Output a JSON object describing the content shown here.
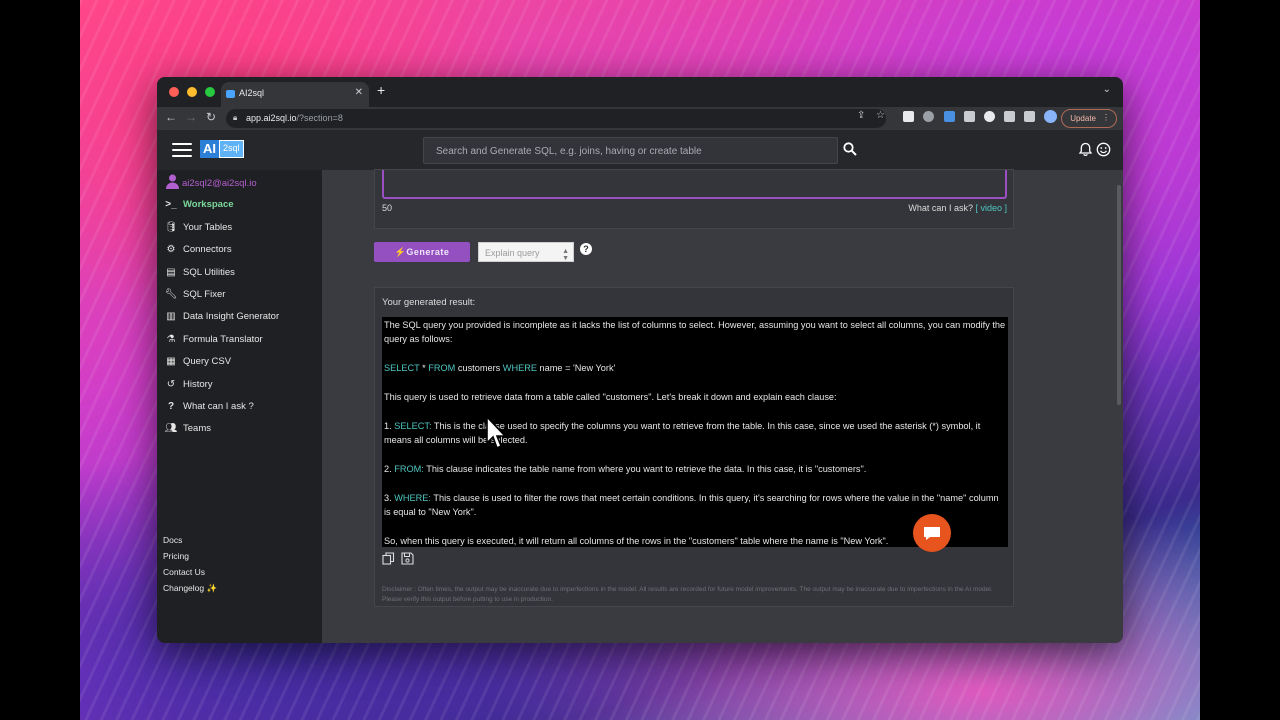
{
  "browser": {
    "tab_title": "AI2sql",
    "url_host": "app.ai2sql.io",
    "url_path": "/?section=8",
    "update_label": "Update"
  },
  "app": {
    "logo_ai": "AI",
    "logo_sql": "2sql",
    "search_placeholder": "Search and Generate SQL, e.g. joins, having or create table"
  },
  "sidebar": {
    "user_email": "ai2sql2@ai2sql.io",
    "items": [
      {
        "label": "Workspace",
        "icon": ">_"
      },
      {
        "label": "Your Tables",
        "icon": "database-icon"
      },
      {
        "label": "Connectors",
        "icon": "gear-icon"
      },
      {
        "label": "SQL Utilities",
        "icon": "file-icon"
      },
      {
        "label": "SQL Fixer",
        "icon": "wrench-icon"
      },
      {
        "label": "Data Insight Generator",
        "icon": "bar-chart-icon"
      },
      {
        "label": "Formula Translator",
        "icon": "flask-icon"
      },
      {
        "label": "Query CSV",
        "icon": "csv-icon"
      },
      {
        "label": "History",
        "icon": "history-icon"
      },
      {
        "label": "What can I ask ?",
        "icon": "question-icon"
      },
      {
        "label": "Teams",
        "icon": "users-icon"
      }
    ],
    "footer": [
      "Docs",
      "Pricing",
      "Contact Us",
      "Changelog ✨"
    ]
  },
  "editor": {
    "count": "50",
    "what_can_i_ask": "What can I ask?",
    "video_link": "[ video ]"
  },
  "controls": {
    "generate_label": "⚡Generate",
    "mode_select": "Explain query",
    "help_label": "?"
  },
  "result": {
    "title": "Your generated result:",
    "p1": "The SQL query you provided is incomplete as it lacks the list of columns to select. However, assuming you want to select all columns, you can modify the query as follows:",
    "sql_select": "SELECT",
    "sql_star": " * ",
    "sql_from": "FROM",
    "sql_table": " customers ",
    "sql_where": "WHERE",
    "sql_cond": " name = 'New York'",
    "p2": "This query is used to retrieve data from a table called \"customers\". Let's break it down and explain each clause:",
    "i1_num": "1. ",
    "i1_kw": "SELECT:",
    "i1_text": " This is the clause used to specify the columns you want to retrieve from the table. In this case, since we used the asterisk (*) symbol, it means all columns will be selected.",
    "i2_num": "2. ",
    "i2_kw": "FROM:",
    "i2_text": " This clause indicates the table name from where you want to retrieve the data. In this case, it is \"customers\".",
    "i3_num": "3. ",
    "i3_kw": "WHERE:",
    "i3_text": " This clause is used to filter the rows that meet certain conditions. In this query, it's searching for rows where the value in the \"name\" column is equal to \"New York\".",
    "p3": "So, when this query is executed, it will return all columns of the rows in the \"customers\" table where the name is \"New York\".",
    "disclaimer": "Disclaimer : Often times, the output may be inaccurate due to imperfections in the model. All results are recorded for future model improvements. The output may be inaccurate due to imperfections in the AI model. Please verify this output before putting to use in production."
  },
  "colors": {
    "accent_purple": "#9450c0",
    "keyword_teal": "#4fc6c0",
    "active_green": "#7cd99b",
    "chat_orange": "#e8541e"
  }
}
